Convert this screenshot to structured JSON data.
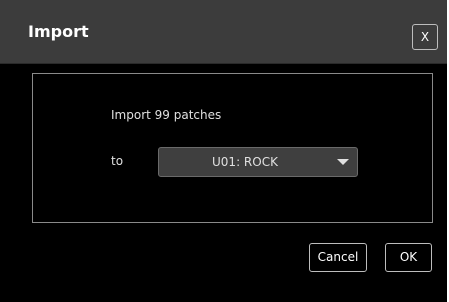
{
  "dialog": {
    "title": "Import",
    "close_label": "X"
  },
  "content": {
    "import_message": "Import 99 patches",
    "to_label": "to",
    "destination_select": {
      "selected": "U01: ROCK"
    }
  },
  "buttons": {
    "cancel_label": "Cancel",
    "ok_label": "OK"
  }
}
